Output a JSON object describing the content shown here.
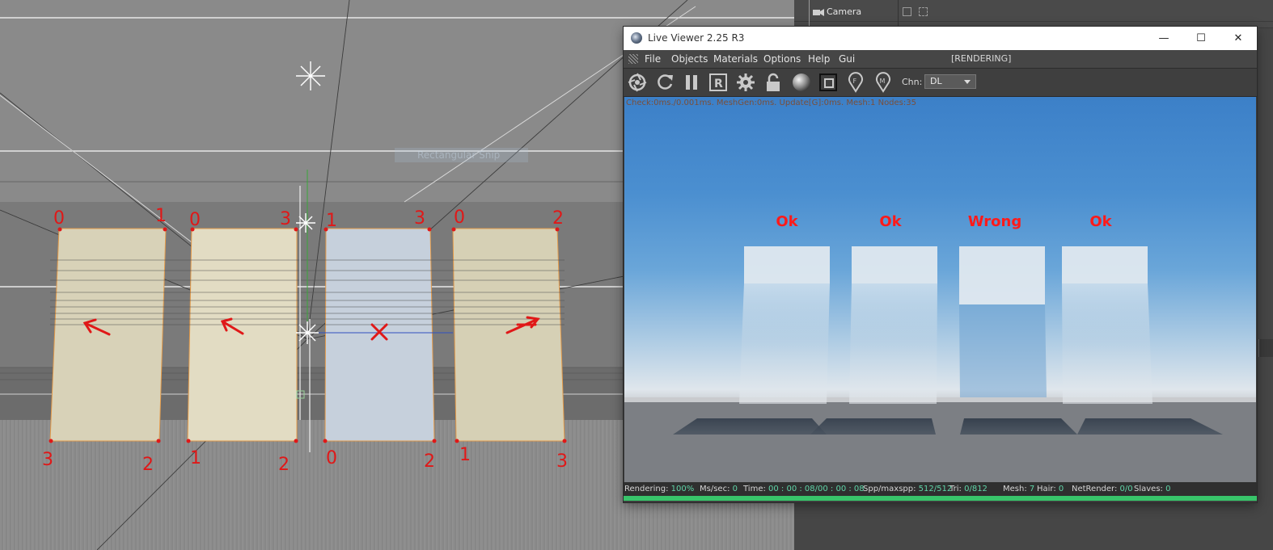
{
  "viewport": {
    "snip_ghost_text": "Rectangular Snip",
    "corner_labels": [
      "0",
      "1",
      "0",
      "3",
      "1",
      "3",
      "0",
      "2",
      "3",
      "2",
      "1",
      "2",
      "0",
      "2",
      "1",
      "3"
    ]
  },
  "object_manager": {
    "camera_label": "Camera"
  },
  "live_viewer": {
    "title": "Live Viewer 2.25 R3",
    "window_buttons": {
      "minimize": "—",
      "maximize": "☐",
      "close": "✕"
    },
    "menu": [
      "File",
      "Objects",
      "Materials",
      "Options",
      "Help",
      "Gui"
    ],
    "status_text": "[RENDERING]",
    "toolbar_icons": [
      "aperture-icon",
      "refresh-icon",
      "pause-icon",
      "render-region-icon",
      "gear-icon",
      "lock-icon",
      "material-sphere-icon",
      "crop-icon",
      "pin-f-icon",
      "pin-m-icon"
    ],
    "toolbar_pin_letters": {
      "f": "F",
      "m": "M"
    },
    "toolbar_region_letter": "R",
    "channel_label": "Chn:",
    "channel_value": "DL",
    "stats_line": "Check:0ms./0.001ms. MeshGen:0ms. Update[G]:0ms. Mesh:1 Nodes:35",
    "render_labels": [
      "Ok",
      "Ok",
      "Wrong",
      "Ok"
    ],
    "statusbar": {
      "rendering_label": "Rendering:",
      "rendering_value": "100%",
      "mssec_label": "Ms/sec:",
      "mssec_value": "0",
      "time_label": "Time:",
      "time_value": "00 : 00 : 08/00 : 00 : 08",
      "spp_label": "Spp/maxspp:",
      "spp_value": "512/512",
      "tri_label": "Tri:",
      "tri_value": "0/812",
      "mesh_label": "Mesh:",
      "mesh_value": "7",
      "hair_label": "Hair:",
      "hair_value": "0",
      "netrender_label": "NetRender:",
      "netrender_value": "0/0",
      "slaves_label": "Slaves:",
      "slaves_value": "0"
    },
    "progress_fraction": 1.0,
    "colors": {
      "accent_green": "#38c46a",
      "label_red": "#ff1a1a"
    }
  }
}
